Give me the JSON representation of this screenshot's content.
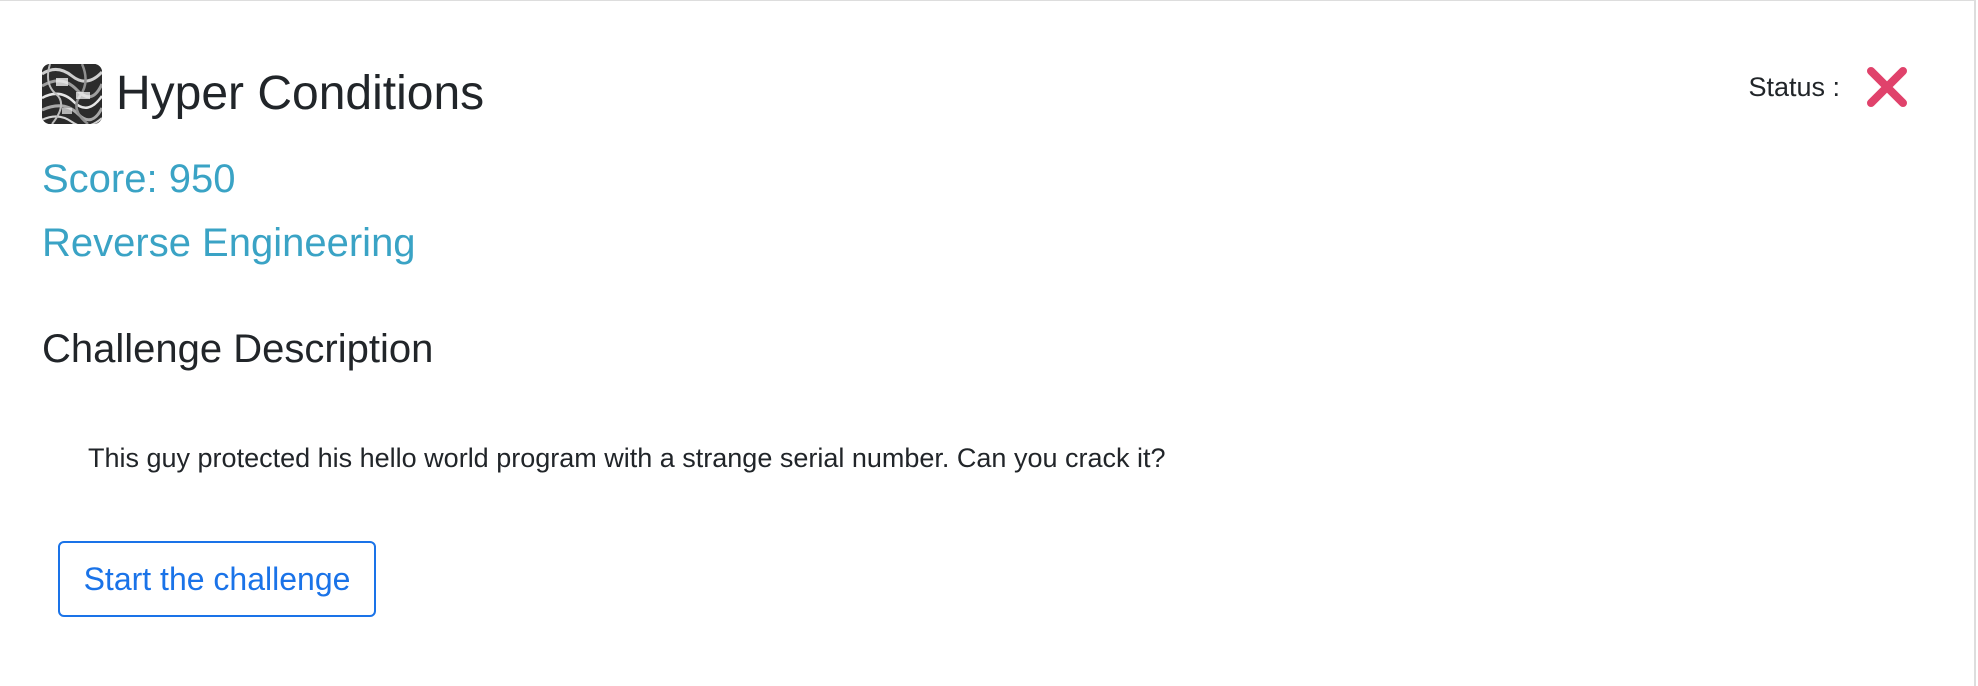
{
  "challenge": {
    "title": "Hyper Conditions",
    "thumbnail_icon": "challenge-thumbnail",
    "score": "Score: 950",
    "category": "Reverse Engineering"
  },
  "status": {
    "label": "Status :",
    "icon": "close-icon",
    "color": "#e0426b"
  },
  "description": {
    "heading": "Challenge Description",
    "text": "This guy protected his hello world program with a strange serial number. Can you crack it?"
  },
  "actions": {
    "start_label": "Start the challenge"
  },
  "colors": {
    "accent": "#3aa3c5",
    "button": "#1a73e8",
    "text": "#212529"
  }
}
